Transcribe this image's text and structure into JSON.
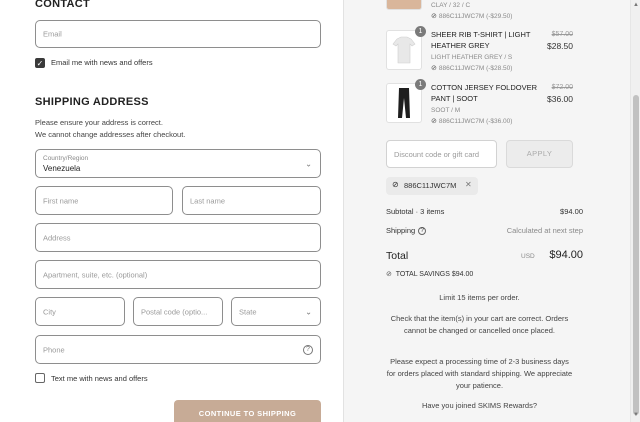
{
  "contact": {
    "heading": "CONTACT",
    "email_placeholder": "Email",
    "email_opt_in_label": "Email me with news and offers"
  },
  "shipping": {
    "heading": "SHIPPING ADDRESS",
    "note_line1": "Please ensure your address is correct.",
    "note_line2": "We cannot change addresses after checkout.",
    "country_label": "Country/Region",
    "country_value": "Venezuela",
    "first_name_placeholder": "First name",
    "last_name_placeholder": "Last name",
    "address_placeholder": "Address",
    "apartment_placeholder": "Apartment, suite, etc. (optional)",
    "city_placeholder": "City",
    "postal_placeholder": "Postal code (optio...",
    "state_placeholder": "State",
    "phone_placeholder": "Phone",
    "text_opt_in_label": "Text me with news and offers",
    "continue_label": "CONTINUE TO SHIPPING"
  },
  "cart": {
    "items": [
      {
        "name": "",
        "variant": "CLAY / 32 / C",
        "discount": "886C11JWC7M (-$29.50)",
        "qty": "",
        "price_old": "",
        "price_new": ""
      },
      {
        "name": "SHEER RIB T-SHIRT | LIGHT HEATHER GREY",
        "variant": "LIGHT HEATHER GREY / S",
        "discount": "886C11JWC7M (-$28.50)",
        "qty": "1",
        "price_old": "$57.00",
        "price_new": "$28.50"
      },
      {
        "name": "COTTON JERSEY FOLDOVER PANT | SOOT",
        "variant": "SOOT / M",
        "discount": "886C11JWC7M (-$36.00)",
        "qty": "1",
        "price_old": "$72.00",
        "price_new": "$36.00"
      }
    ],
    "discount_placeholder": "Discount code or gift card",
    "apply_label": "APPLY",
    "applied_code": "886C11JWC7M",
    "subtotal_label": "Subtotal · 3 items",
    "subtotal_value": "$94.00",
    "shipping_label": "Shipping",
    "shipping_value": "Calculated at next step",
    "total_label": "Total",
    "total_currency": "USD",
    "total_value": "$94.00",
    "savings_label": "TOTAL SAVINGS",
    "savings_value": "$94.00",
    "note_limit": "Limit 15 items per order.",
    "note_check": "Check that the item(s) in your cart are correct. Orders cannot be changed or cancelled once placed.",
    "note_processing": "Please expect a processing time of 2-3 business days for orders placed with standard shipping. We appreciate your patience.",
    "note_rewards": "Have you joined SKIMS Rewards?"
  },
  "icons": {
    "tag": "tag-icon",
    "close": "close-icon",
    "info": "info-icon",
    "help": "help-icon",
    "chevron": "chevron-down-icon",
    "check": "check-icon"
  },
  "colors": {
    "accent_button": "#c7ab96",
    "summary_bg": "#f5f5f5"
  }
}
